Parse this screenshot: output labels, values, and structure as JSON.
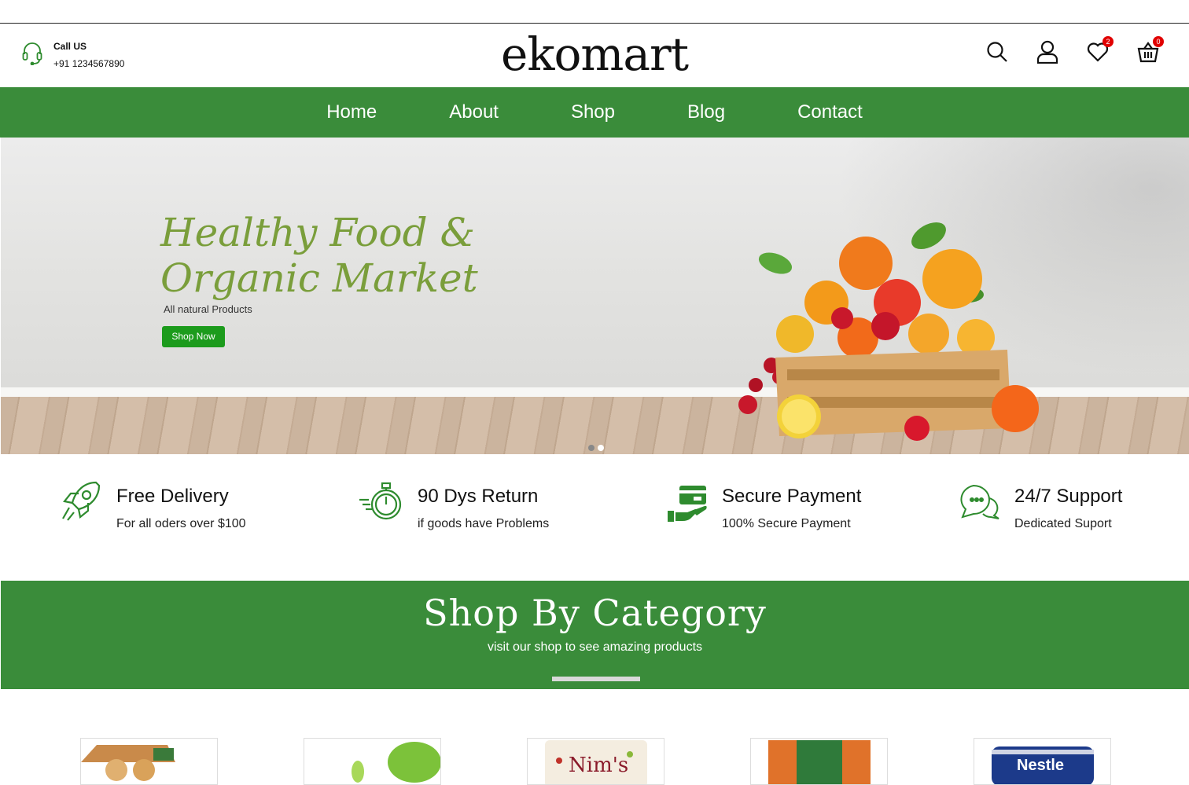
{
  "header": {
    "call_title": "Call US",
    "call_phone": "+91 1234567890",
    "logo": "ekomart",
    "wishlist_count": "2",
    "cart_count": "0"
  },
  "nav": {
    "items": [
      {
        "label": "Home"
      },
      {
        "label": "About"
      },
      {
        "label": "Shop"
      },
      {
        "label": "Blog"
      },
      {
        "label": "Contact"
      }
    ]
  },
  "hero": {
    "title_line1": "Healthy Food &",
    "title_line2": "Organic Market",
    "subtitle": "All natural Products",
    "button": "Shop Now",
    "slides": 2,
    "active_slide": 2
  },
  "features": [
    {
      "icon": "rocket-icon",
      "title": "Free Delivery",
      "subtitle": "For all oders over $100"
    },
    {
      "icon": "stopwatch-icon",
      "title": "90 Dys Return",
      "subtitle": "if goods have Problems"
    },
    {
      "icon": "secure-payment-icon",
      "title": "Secure Payment",
      "subtitle": "100% Secure Payment"
    },
    {
      "icon": "chat-support-icon",
      "title": "24/7 Support",
      "subtitle": "Dedicated Suport"
    }
  ],
  "category": {
    "title": "Shop By Category",
    "subtitle": "visit our shop to see amazing products"
  },
  "product_cards": [
    {
      "brand": ""
    },
    {
      "brand": ""
    },
    {
      "brand": "Nim's"
    },
    {
      "brand": ""
    },
    {
      "brand": "Nestle"
    }
  ],
  "colors": {
    "brand_green": "#3a8c3a",
    "button_green": "#1c9b1c",
    "hero_title": "#7a9e3b",
    "badge_red": "#e10000"
  }
}
